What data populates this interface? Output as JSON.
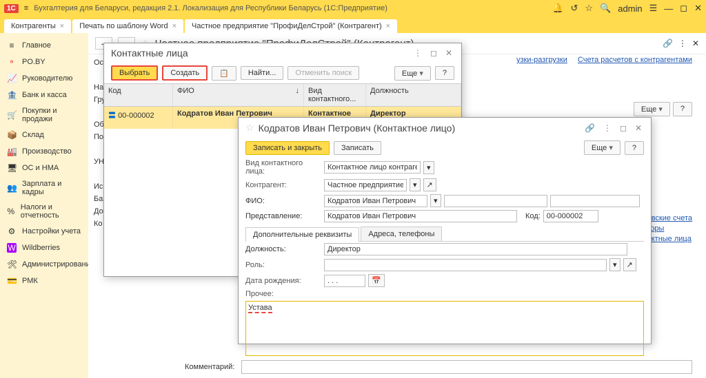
{
  "titlebar": {
    "logo": "1C",
    "app_title": "Бухгалтерия для Беларуси, редакция 2.1. Локализация для Республики Беларусь   (1С:Предприятие)",
    "user": "admin"
  },
  "tabs": [
    {
      "label": "Контрагенты",
      "close": "×"
    },
    {
      "label": "Печать по шаблону Word",
      "close": "×"
    },
    {
      "label": "Частное предприятие \"ПрофиДелСтрой\" (Контрагент)",
      "close": "×"
    }
  ],
  "sidebar": [
    {
      "icon": "≡",
      "label": "Главное"
    },
    {
      "icon": "⚬",
      "label": "PO.BY"
    },
    {
      "icon": "📈",
      "label": "Руководителю"
    },
    {
      "icon": "🏦",
      "label": "Банк и касса"
    },
    {
      "icon": "🛒",
      "label": "Покупки и продажи"
    },
    {
      "icon": "📦",
      "label": "Склад"
    },
    {
      "icon": "🏭",
      "label": "Производство"
    },
    {
      "icon": "🖥",
      "label": "ОС и НМА"
    },
    {
      "icon": "👥",
      "label": "Зарплата и кадры"
    },
    {
      "icon": "%",
      "label": "Налоги и отчетность"
    },
    {
      "icon": "⚙",
      "label": "Настройки учета"
    },
    {
      "icon": "W",
      "label": "Wildberries"
    },
    {
      "icon": "🛠",
      "label": "Администрирование"
    },
    {
      "icon": "💳",
      "label": "РМК"
    }
  ],
  "doc": {
    "title": "Частное предприятие \"ПрофиДелСтрой\" (Контрагент)",
    "link1": "узки-разгрузки",
    "link2": "Счета расчетов с контрагентами",
    "more": "Еще",
    "help": "?",
    "comment_label": "Комментарий:",
    "side_labels": {
      "os": "Ос",
      "nai": "Наи",
      "gru": "Гру",
      "ob": "Об",
      "po": "По",
      "un": "УН",
      "is": "Ис",
      "ba": "Ба",
      "do": "До",
      "ko": "Ко"
    }
  },
  "rlinks": {
    "b": "анковские счета",
    "d": "оговоры",
    "k": "онтактные лица"
  },
  "modal1": {
    "title": "Контактные лица",
    "select": "Выбрать",
    "create": "Создать",
    "find": "Найти...",
    "cancel": "Отменить поиск",
    "more": "Еще",
    "help": "?",
    "cols": {
      "code": "Код",
      "fio": "ФИО",
      "vid": "Вид контактного...",
      "dolj": "Должность"
    },
    "row": {
      "code": "00-000002",
      "fio": "Кодратов Иван Петрович",
      "vid": "Контактное ли...",
      "dolj": "Директор"
    }
  },
  "modal2": {
    "title": "Кодратов Иван Петрович (Контактное лицо)",
    "save_close": "Записать и закрыть",
    "save": "Записать",
    "more": "Еще",
    "help": "?",
    "vid_label": "Вид контактного лица:",
    "vid_value": "Контактное лицо контраген",
    "ka_label": "Контрагент:",
    "ka_value": "Частное предприятие \"",
    "fio_label": "ФИО:",
    "fio_value": "Кодратов Иван Петрович",
    "pred_label": "Представление:",
    "pred_value": "Кодратов Иван Петрович",
    "code_label": "Код:",
    "code_value": "00-000002",
    "tab1": "Дополнительные реквизиты",
    "tab2": "Адреса, телефоны",
    "dolj_label": "Должность:",
    "dolj_value": "Директор",
    "role_label": "Роль:",
    "role_value": "",
    "dob_label": "Дата рождения:",
    "dob_value": ". . .",
    "other_label": "Прочее:",
    "other_value": "Устава"
  }
}
